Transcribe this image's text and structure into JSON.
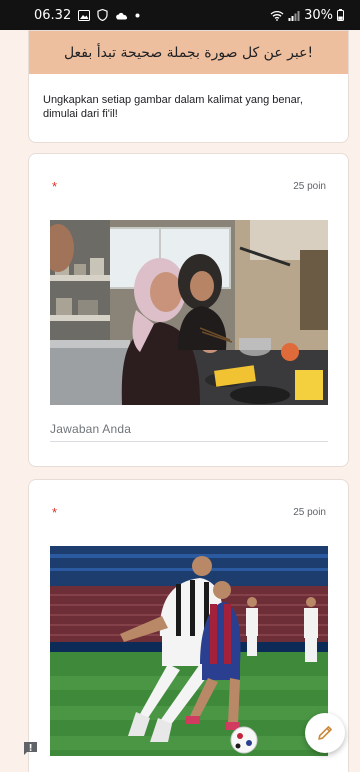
{
  "status_bar": {
    "time": "06.32",
    "battery": "30%",
    "icons": [
      "gallery-icon",
      "vpn-shield-icon",
      "cloud-icon",
      "dot-icon",
      "wifi-icon",
      "signal-icon",
      "battery-icon"
    ]
  },
  "form": {
    "header_title": "!عبر عن كل صورة بجملة صحيحة تبدأ بفعل",
    "header_description": "Ungkapkan setiap gambar dalam kalimat yang benar, dimulai dari fi'il!",
    "accent_color": "#edbf9e"
  },
  "questions": [
    {
      "required_mark": "*",
      "points": "25 poin",
      "image": "kitchen-cooking-photo",
      "answer_placeholder": "Jawaban Anda"
    },
    {
      "required_mark": "*",
      "points": "25 poin",
      "image": "football-match-photo"
    }
  ],
  "fab": {
    "icon": "pencil-icon"
  },
  "feedback": {
    "icon": "feedback-icon"
  }
}
